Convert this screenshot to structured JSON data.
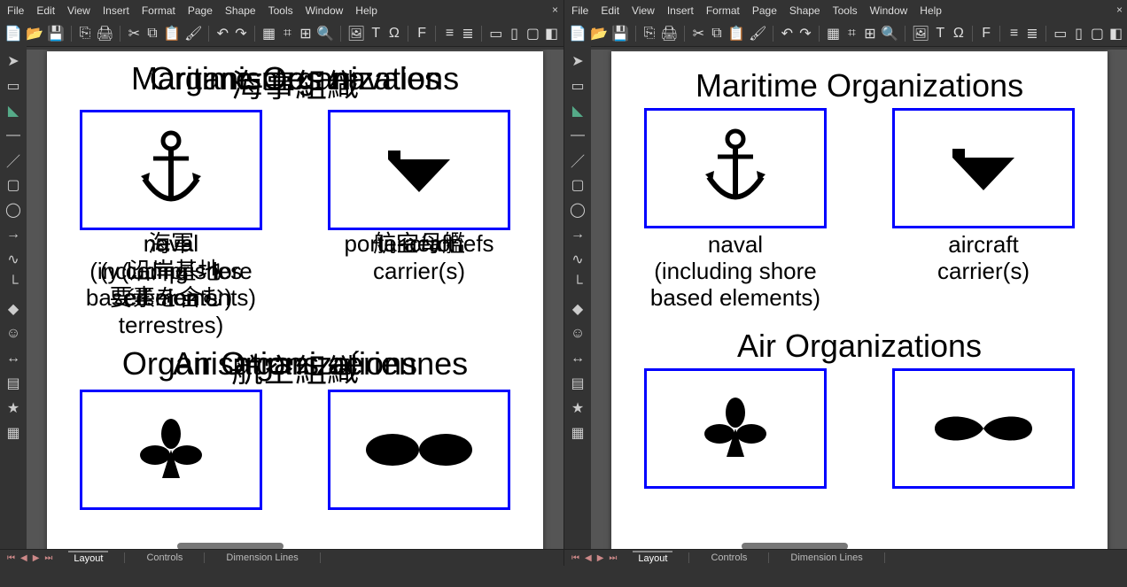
{
  "menus": [
    "File",
    "Edit",
    "View",
    "Insert",
    "Format",
    "Page",
    "Shape",
    "Tools",
    "Window",
    "Help"
  ],
  "toolbar_icons": [
    "new-doc-icon",
    "templates-icon",
    "open-icon",
    "save-icon",
    "sep",
    "export-pdf-icon",
    "print-direct-icon",
    "print-icon",
    "sep",
    "cut-icon",
    "copy-icon",
    "paste-icon",
    "clone-format-icon",
    "sep",
    "undo-icon",
    "redo-icon",
    "sep",
    "grid-icon",
    "snap-icon",
    "helplines-icon",
    "zoom-icon",
    "sep",
    "image-icon",
    "textbox-icon",
    "special-char-icon",
    "sep",
    "fontwork-icon",
    "hyperlink-icon",
    "sep",
    "align-left-icon",
    "align-center-icon",
    "align-right-icon",
    "sep",
    "arrange-front-icon",
    "arrange-forward-icon",
    "arrange-backward-icon",
    "arrange-back-icon",
    "sep",
    "shadow-icon",
    "crop-icon",
    "filter-icon",
    "3d-icon"
  ],
  "side_icons": [
    "select-icon",
    "rectangle-icon",
    "paint-bucket-icon",
    "line-color-icon",
    "line-icon",
    "rect-outline-icon",
    "ellipse-icon",
    "arrow-icon",
    "curve-icon",
    "connector-icon",
    "basic-shapes-icon",
    "symbol-icon",
    "double-arrow-icon",
    "callout-icon",
    "star-icon",
    "3d-object-icon"
  ],
  "status_tabs": {
    "layout": "Layout",
    "controls": "Controls",
    "dimension": "Dimension Lines"
  },
  "left_page": {
    "title_layers": [
      "Maritime Organizations",
      "Organismes navales",
      "海事組織"
    ],
    "naval_box_icon": "anchor-icon",
    "carrier_box_icon": "carrier-icon",
    "naval_caption_layers": [
      "naval\n(including shore\nbased elements)",
      "naval\n(y compris les\néléments\nterrestres)",
      "海軍\n(沿岸基地\n要素を含む)"
    ],
    "carrier_caption_layers": [
      "aircraft\ncarrier(s)",
      "porte-aéronefs",
      "航空母艦"
    ],
    "air_title_layers": [
      "Air Organizations",
      "Organisations aériennes",
      "航空組織"
    ],
    "clover_box_icon": "clover-icon",
    "propeller_box_icon": "propeller-icon"
  },
  "right_page": {
    "title": "Maritime Organizations",
    "naval_caption": "naval\n(including shore\nbased elements)",
    "carrier_caption": "aircraft\ncarrier(s)",
    "air_title": "Air Organizations"
  },
  "close_label": "×"
}
